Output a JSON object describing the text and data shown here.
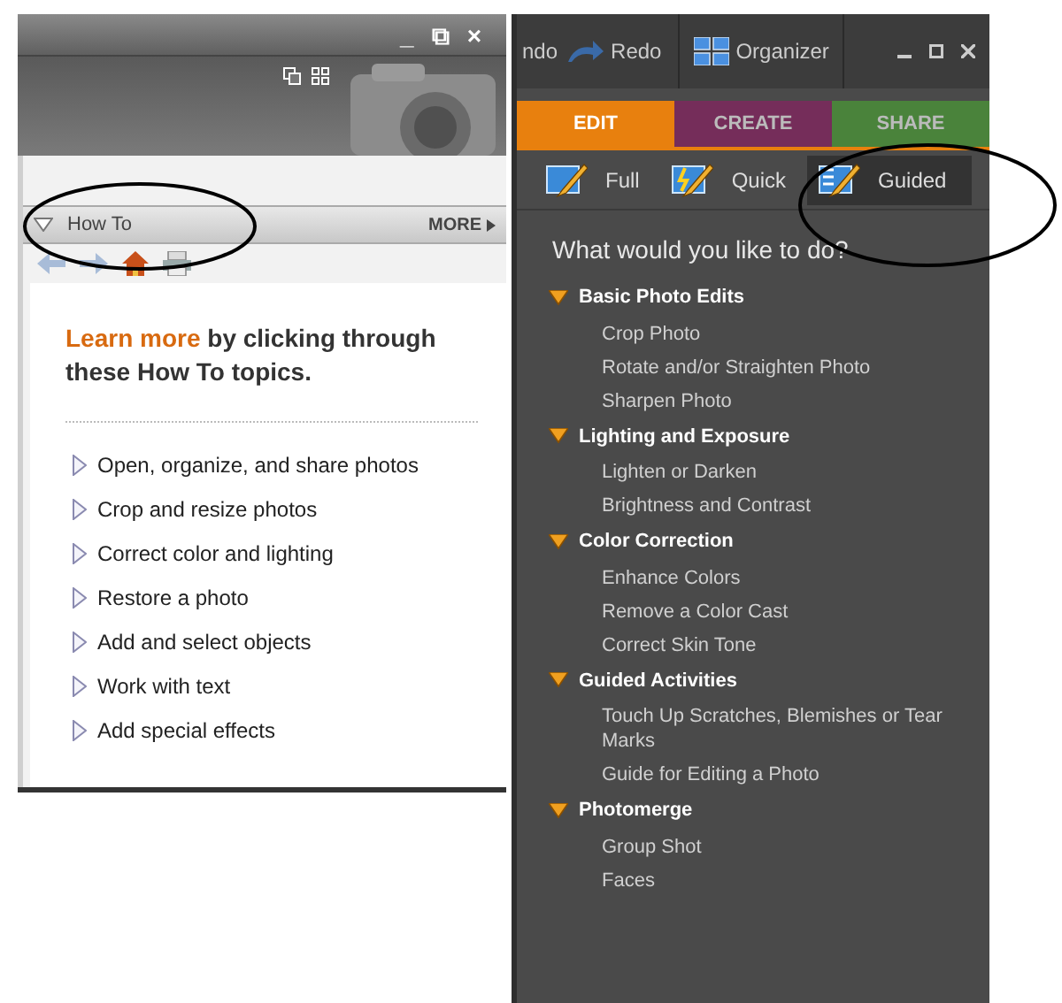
{
  "help_window": {
    "controls": [
      "_",
      "⧉",
      "×"
    ],
    "panel": {
      "title": "How To",
      "expanded": true,
      "more": "MORE",
      "intro": "**Learn more** by clicking through these How To topics.",
      "topics": [
        "Open, organize, and share photos",
        "Crop and resize photos",
        "Correct color and lighting",
        "Restore a photo",
        "Add and select objects",
        "Work with text",
        "Add special effects"
      ]
    }
  },
  "editor": {
    "toolbar": [
      {
        "kind": "undo",
        "label": "ndo"
      },
      {
        "kind": "redo",
        "label": "Redo"
      },
      {
        "kind": "organizer",
        "label": "Organizer"
      }
    ],
    "tabs": [
      {
        "label": "EDIT",
        "selected": true,
        "color": "#e8800e"
      },
      {
        "label": "CREATE",
        "selected": false,
        "color": "#7a2a5c"
      },
      {
        "label": "SHARE",
        "selected": false,
        "color": "#4a8a3a"
      }
    ],
    "modes": [
      {
        "label": "Full",
        "selected": false
      },
      {
        "label": "Quick",
        "selected": false
      },
      {
        "label": "Guided",
        "selected": true
      }
    ],
    "heading": "What would you like to do?",
    "groups": [
      {
        "label": "Basic Photo Edits",
        "expanded": true,
        "children": [
          "Crop Photo",
          "Rotate and/or Straighten Photo",
          "Sharpen Photo"
        ]
      },
      {
        "label": "Lighting and Exposure",
        "expanded": true,
        "children": [
          "Lighten or Darken",
          "Brightness and Contrast"
        ]
      },
      {
        "label": "Color Correction",
        "expanded": true,
        "children": [
          "Enhance Colors",
          "Remove a Color Cast",
          "Correct Skin Tone"
        ]
      },
      {
        "label": "Guided Activities",
        "expanded": true,
        "children": [
          "Touch Up Scratches, Blemishes or Tear Marks",
          "Guide for Editing a Photo"
        ]
      },
      {
        "label": "Photomerge",
        "expanded": true,
        "children": [
          "Group Shot",
          "Faces"
        ]
      }
    ]
  }
}
